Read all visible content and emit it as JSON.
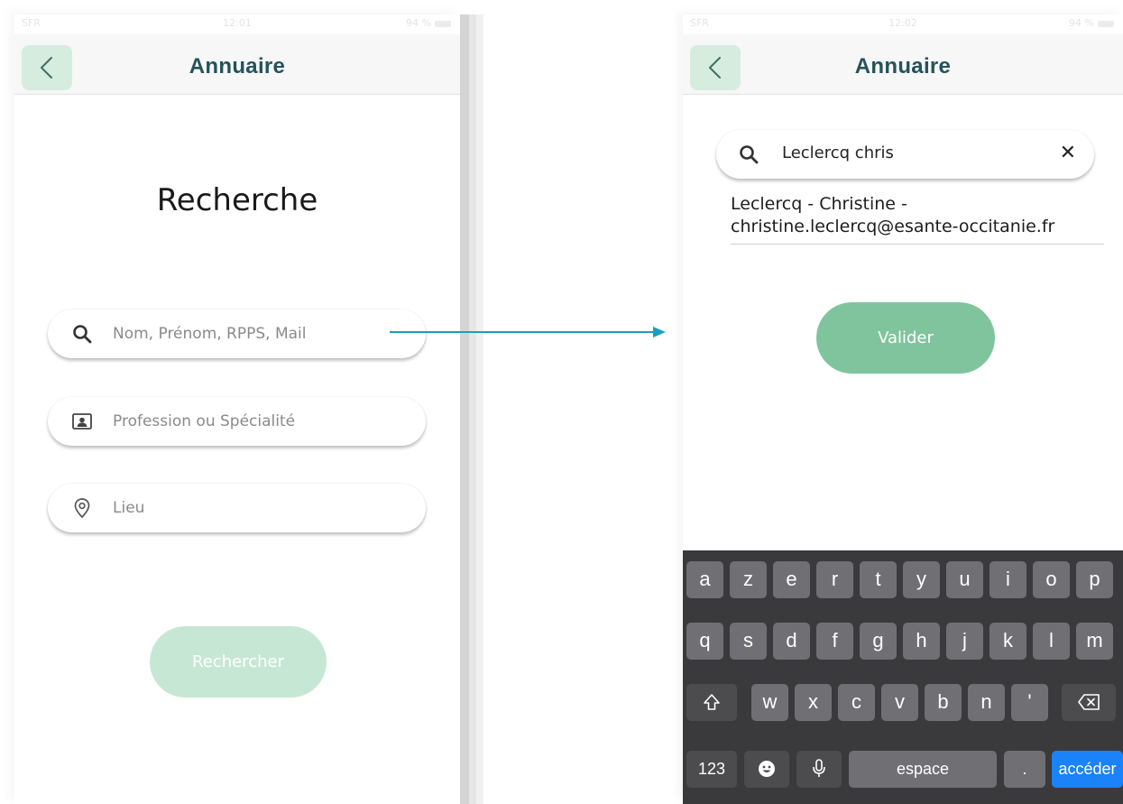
{
  "status_left": {
    "carrier": "SFR",
    "time": "12:01",
    "battery": "94 %"
  },
  "status_right": {
    "carrier": "SFR",
    "time": "12:02",
    "battery": "94 %"
  },
  "left_screen": {
    "title": "Annuaire",
    "heading": "Recherche",
    "fields": [
      {
        "icon": "search-icon",
        "placeholder": "Nom, Prénom, RPPS, Mail"
      },
      {
        "icon": "id-card-icon",
        "placeholder": "Profession ou Spécialité"
      },
      {
        "icon": "location-pin-icon",
        "placeholder": "Lieu"
      }
    ],
    "search_button": "Rechercher",
    "button_color": "#c7e7d5"
  },
  "right_screen": {
    "title": "Annuaire",
    "search_value": "Leclercq chris",
    "clear_symbol": "✕",
    "result": "Leclercq - Christine - christine.leclercq@esante-occitanie.fr",
    "validate_button": "Valider",
    "button_color": "#80c49d"
  },
  "keyboard": {
    "row1": [
      "a",
      "z",
      "e",
      "r",
      "t",
      "y",
      "u",
      "i",
      "o",
      "p"
    ],
    "row2": [
      "q",
      "s",
      "d",
      "f",
      "g",
      "h",
      "j",
      "k",
      "l",
      "m"
    ],
    "row3": [
      "w",
      "x",
      "c",
      "v",
      "b",
      "n",
      "'"
    ],
    "numbers_key": "123",
    "space_key": "espace",
    "period_key": ".",
    "go_key": "accéder"
  },
  "colors": {
    "title": "#24535b",
    "back_button": "#d6ecdf",
    "arrow": "#1a9fc0",
    "keyboard_go": "#1a82fb"
  }
}
